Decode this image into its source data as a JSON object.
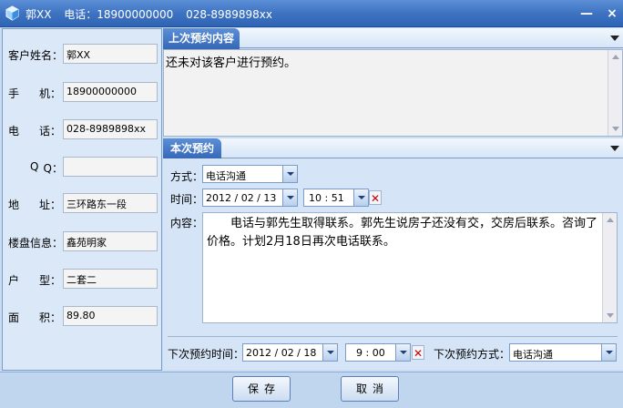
{
  "window": {
    "name": "郭XX",
    "phone_text": "电话：18900000000",
    "tel_text": "028-8989898xx",
    "minimize_glyph": "—",
    "close_glyph": "×"
  },
  "customer": {
    "name_label": "客户姓名：",
    "name": "郭XX",
    "mobile_label": [
      "手",
      "机："
    ],
    "mobile": "18900000000",
    "tel_label": [
      "电",
      "话："
    ],
    "tel": "028-8989898xx",
    "qq_label": [
      "Q",
      "Q："
    ],
    "qq": "",
    "address_label": [
      "地",
      "址："
    ],
    "address": "三环路东一段",
    "estate_label": "楼盘信息：",
    "estate": "鑫苑明家",
    "house_type_label": [
      "户",
      "型："
    ],
    "house_type": "二套二",
    "area_label": [
      "面",
      "积："
    ],
    "area": "89.80"
  },
  "last_appointment": {
    "header": "上次预约内容",
    "content": "还未对该客户进行预约。"
  },
  "this_appointment": {
    "header": "本次预约",
    "method_label": "方式：",
    "method": "电话沟通",
    "time_label": "时间：",
    "date": "2012 / 02 / 13",
    "time": "10 : 51",
    "content_label": "内容：",
    "content": "电话与郭先生取得联系。郭先生说房子还没有交，交房后联系。咨询了价格。计划2月18日再次电话联系。",
    "next_time_label": "下次预约时间：",
    "next_date": "2012 / 02 / 18",
    "next_time": "9 : 00",
    "next_method_label": "下次预约方式：",
    "next_method": "电话沟通"
  },
  "buttons": {
    "save": "保存",
    "cancel": "取消"
  },
  "colors": {
    "titlebar": "#3e73c2",
    "panel": "#dbe8f7",
    "accent": "#5b8fd6"
  }
}
